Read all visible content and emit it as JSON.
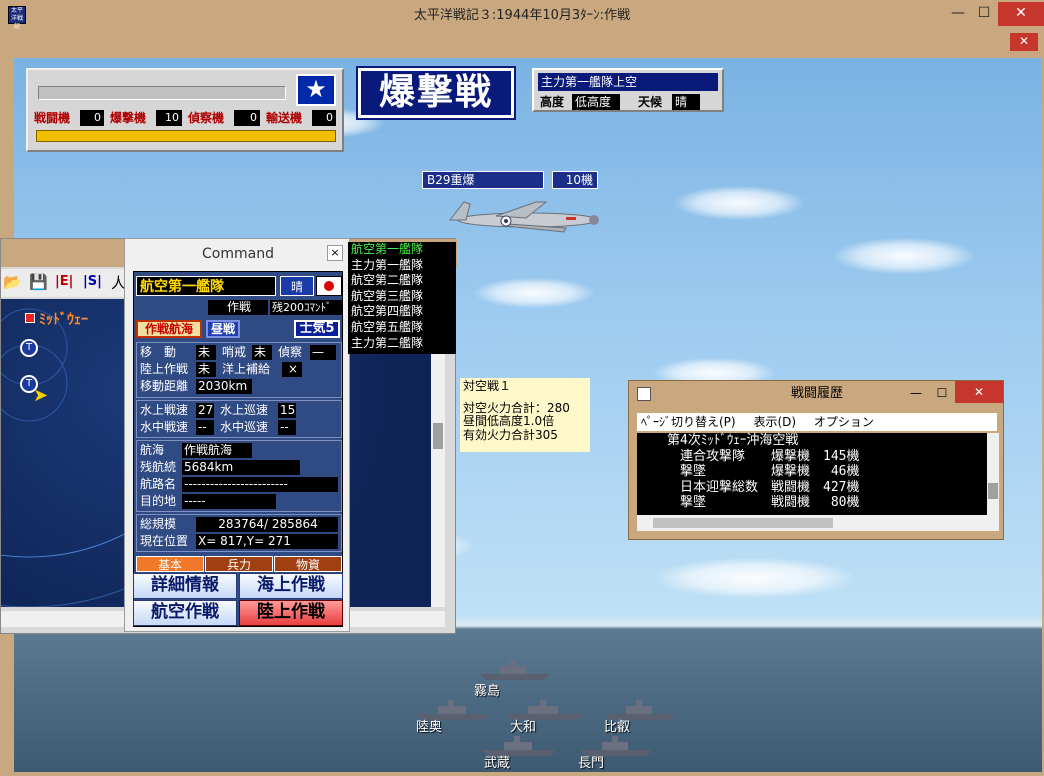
{
  "window": {
    "title": "太平洋戦記３:1944年10月3ﾀｰﾝ:作戦",
    "app_icon_text": "太平洋戦記"
  },
  "status_panel": {
    "counts": [
      {
        "label": "戦闘機",
        "value": "0"
      },
      {
        "label": "爆撃機",
        "value": "10"
      },
      {
        "label": "偵察機",
        "value": "0"
      },
      {
        "label": "輸送機",
        "value": "0"
      }
    ],
    "star": "★"
  },
  "battle_title": "爆撃戦",
  "fleet_info": {
    "name": "主力第一艦隊上空",
    "altitude_label": "高度",
    "altitude_value": "低高度",
    "weather_label": "天候",
    "weather_value": "晴"
  },
  "enemy": {
    "type": "B29重爆",
    "count": "10機"
  },
  "command": {
    "title": "Command",
    "close": "×",
    "fleet_name": "航空第一艦隊",
    "weather": "晴",
    "mode": "作戦",
    "remaining": "残200ｺﾏﾝﾄﾞ",
    "badge_op": "作戦航海",
    "badge_time": "昼戦",
    "morale": "士気5",
    "move_label": "移　動",
    "move_value": "未",
    "patrol_label": "哨戒",
    "patrol_value": "未",
    "recon_label": "偵察",
    "recon_value": "—",
    "land_label": "陸上作戦",
    "land_value": "未",
    "supply_label": "洋上補給",
    "supply_value": "×",
    "distance_label": "移動距離",
    "distance_value": "2030km",
    "surface_speed_label": "水上戦速",
    "surface_speed_value": "27",
    "surface_cruise_label": "水上巡速",
    "surface_cruise_value": "15",
    "under_speed_label": "水中戦速",
    "under_speed_value": "--",
    "under_cruise_label": "水中巡速",
    "under_cruise_value": "--",
    "voyage_label": "航海",
    "voyage_value": "作戦航海",
    "range_label": "残航続",
    "range_value": "5684km",
    "route_label": "航路名",
    "route_value": "------------------------",
    "dest_label": "目的地",
    "dest_value": "-----",
    "scale_label": "総規模",
    "scale_value": "283764/ 285864",
    "pos_label": "現在位置",
    "pos_value": "X= 817,Y= 271",
    "tabs": [
      "基本",
      "兵力",
      "物資"
    ],
    "buttons": [
      "詳細情報",
      "海上作戦",
      "航空作戦",
      "陸上作戦"
    ]
  },
  "fleet_list": [
    "航空第一艦隊",
    "主力第一艦隊",
    "航空第二艦隊",
    "航空第三艦隊",
    "航空第四艦隊",
    "航空第五艦隊",
    "主力第二艦隊"
  ],
  "map": {
    "midway": "ﾐｯﾄﾞｳｪｰ"
  },
  "aa_info": {
    "title": "対空戦１",
    "line1": "対空火力合計：280",
    "line2": "昼間低高度1.0倍",
    "line3": "有効火力合計305"
  },
  "history": {
    "title": "戦闘履歴",
    "menu": [
      "ﾍﾟｰｼﾞ切り替え(P)",
      "表示(D)",
      "オプション"
    ],
    "lines": [
      "第4次ﾐｯﾄﾞｳｪｰ沖海空戦",
      "　連合攻撃隊　　爆撃機　145機",
      "　撃墜　　　　　爆撃機　 46機",
      "　日本迎撃総数　戦闘機　427機",
      "　撃墜　　　　　戦闘機　 80機"
    ]
  },
  "ships": [
    "霧島",
    "陸奥",
    "大和",
    "比叡",
    "武蔵",
    "長門"
  ]
}
